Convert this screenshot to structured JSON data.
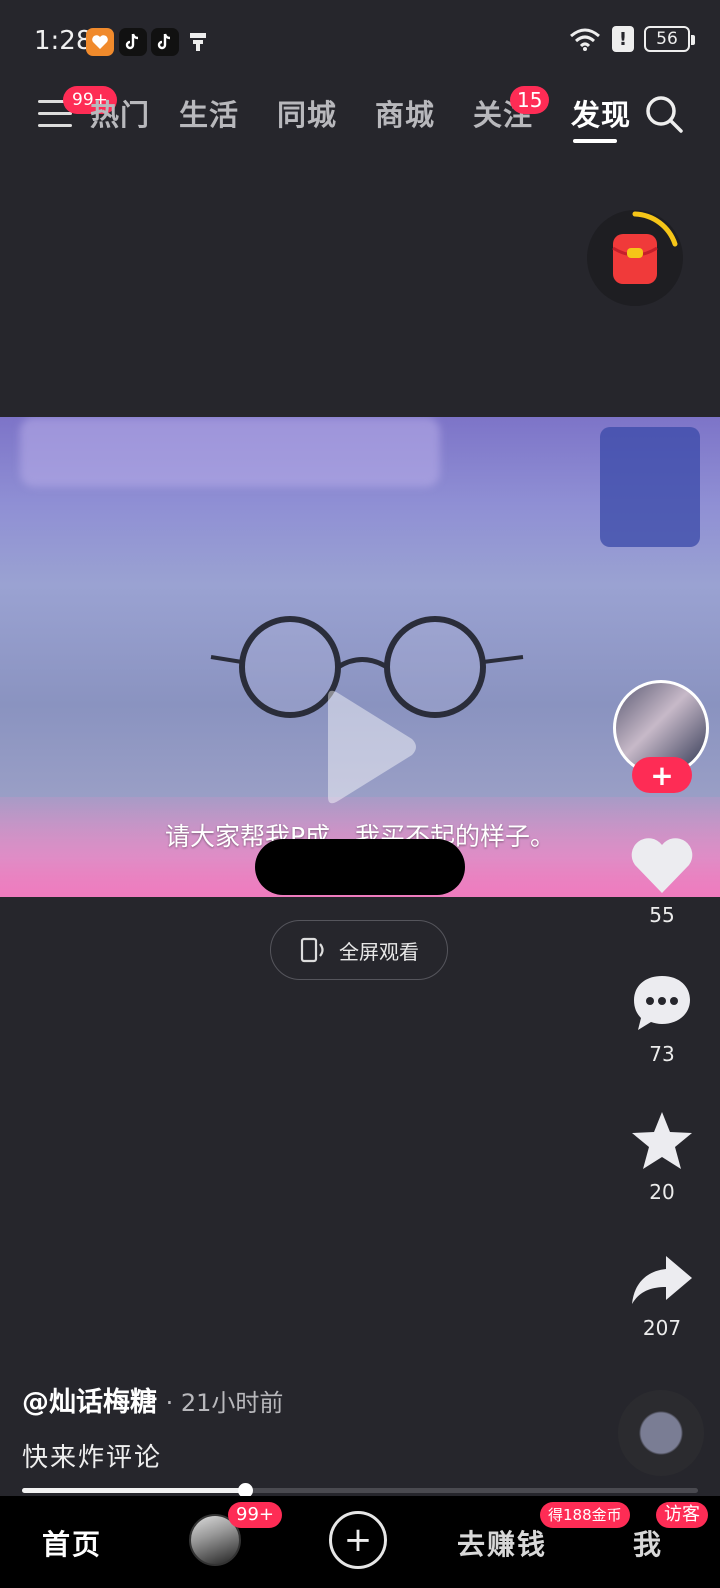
{
  "status_bar": {
    "time": "1:28",
    "battery": "56"
  },
  "top_nav": {
    "menu_badge": "99+",
    "tabs": [
      {
        "label": "热门"
      },
      {
        "label": "生活"
      },
      {
        "label": "同城"
      },
      {
        "label": "商城"
      },
      {
        "label": "关注",
        "badge": "15"
      },
      {
        "label": "发现",
        "active": true
      }
    ],
    "icons": {
      "menu": "menu-icon",
      "search": "search-icon"
    }
  },
  "video": {
    "subtitle": "请大家帮我P成，我买不起的样子。",
    "fullscreen_label": "全屏观看"
  },
  "actions": {
    "likes": "55",
    "comments": "73",
    "favorites": "20",
    "shares": "207",
    "follow_label": "+"
  },
  "post": {
    "author": "@灿话梅糖",
    "time_ago": "· 21小时前",
    "caption": "快来炸评论"
  },
  "playback": {
    "progress": 0.33
  },
  "bottom_nav": {
    "home": "首页",
    "friends_badge": "99+",
    "add": "+",
    "earn": "去赚钱",
    "earn_badge": "得188金币",
    "me": "我",
    "me_badge": "访客"
  },
  "colors": {
    "accent": "#fe2c55",
    "background": "#26262c"
  }
}
